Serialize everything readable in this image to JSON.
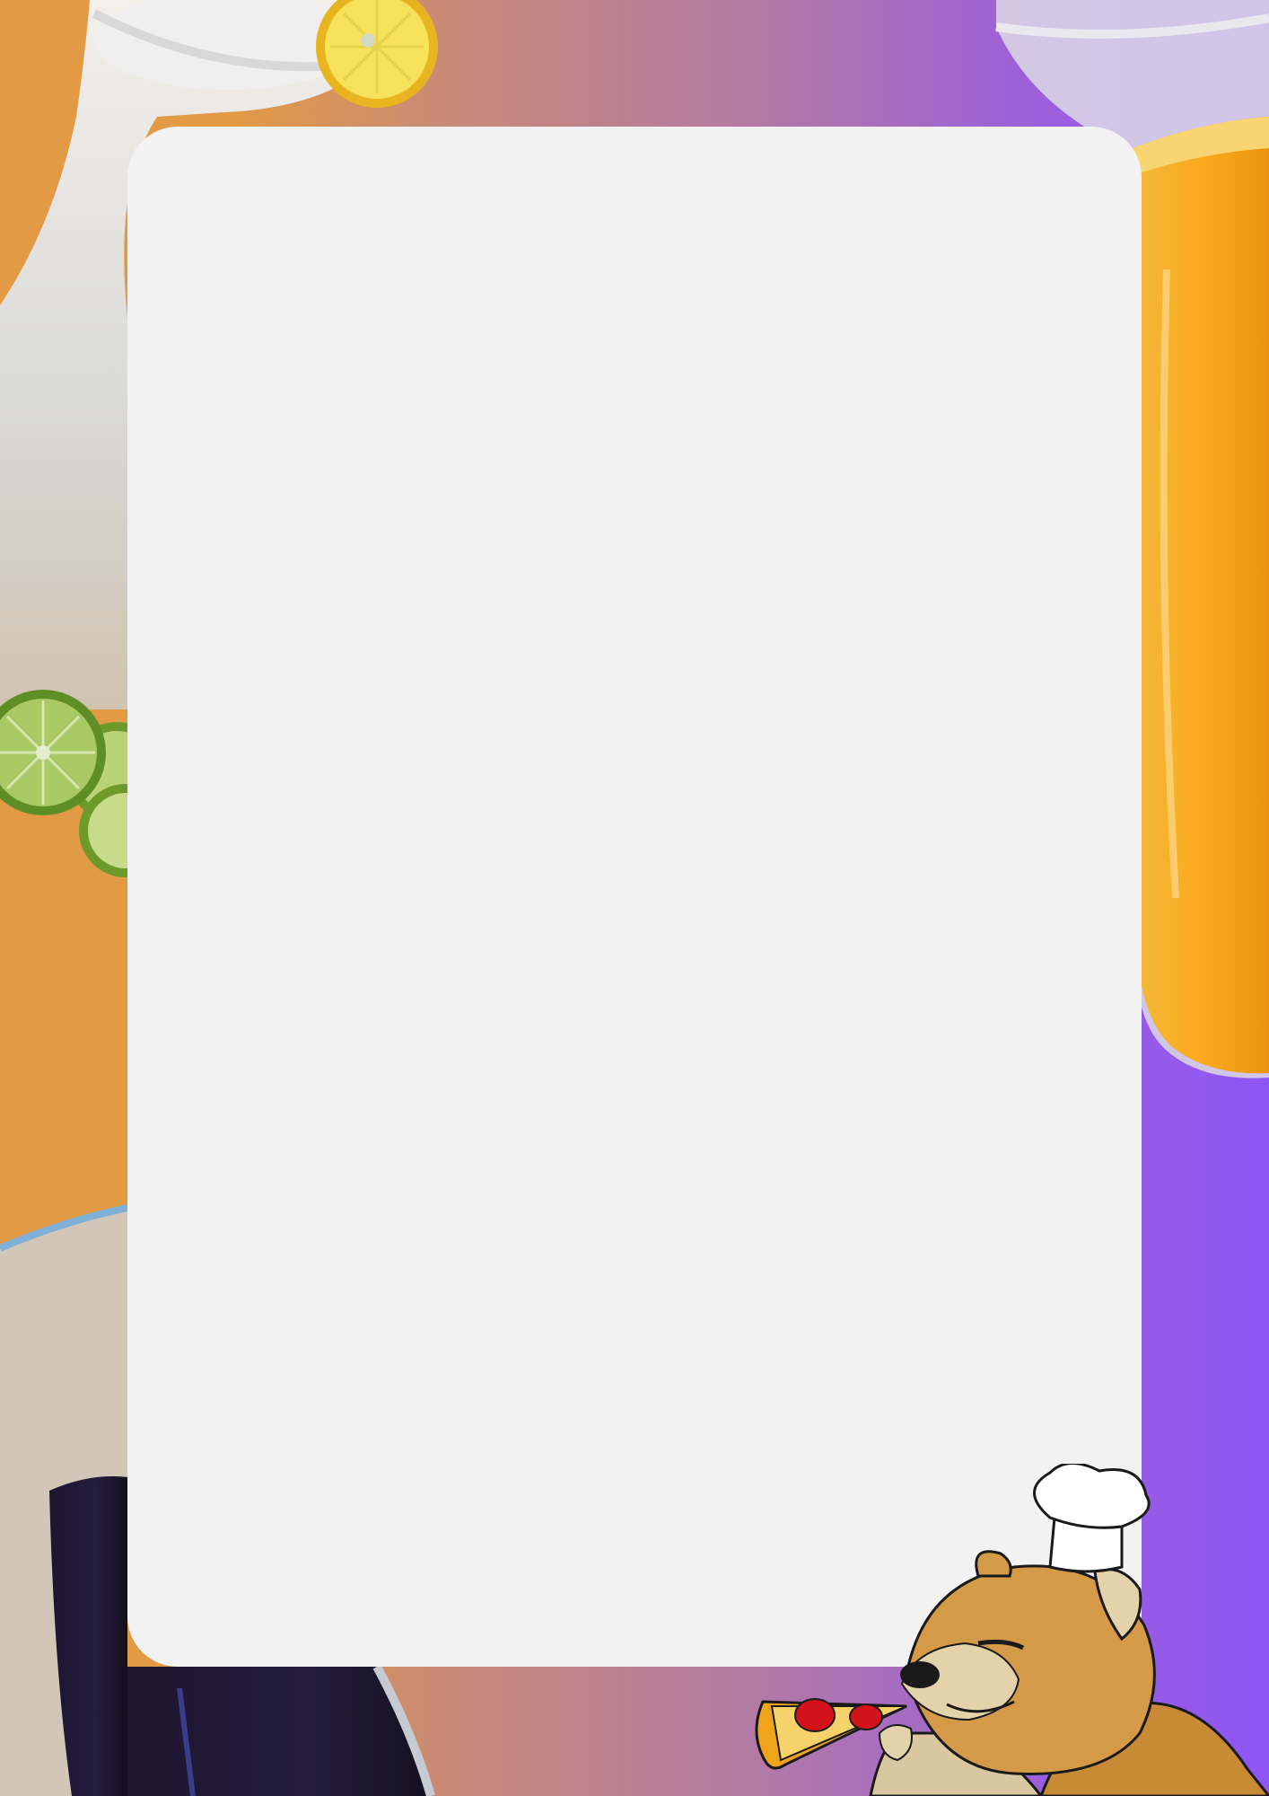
{
  "page": {
    "background_gradient": [
      "#e39a44",
      "#c98a76",
      "#b27aa6",
      "#9e60d8",
      "#8f55f5"
    ],
    "card_color": "#f2f2f2"
  },
  "decorations": {
    "top_left": "lemonade-glass-with-lemon-slice",
    "left_middle": "lime-halves",
    "top_right": "orange-juice-pitcher",
    "bottom_left": "dark-grape-juice-pitcher",
    "bottom_right": "shiba-chef-eating-pizza"
  }
}
